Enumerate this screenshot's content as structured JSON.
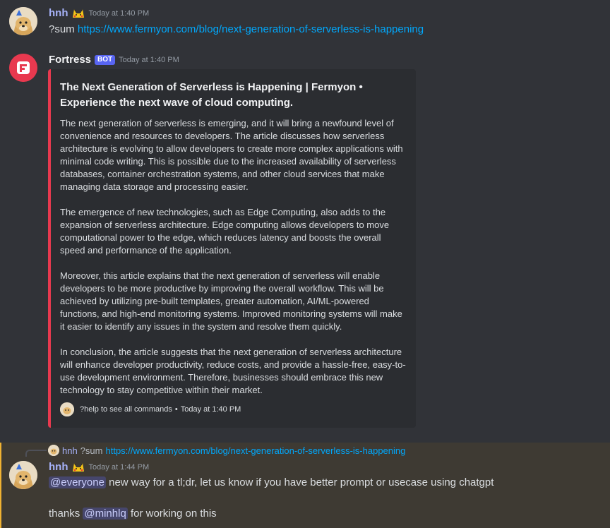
{
  "messages": [
    {
      "username": "hnh",
      "timestamp": "Today at 1:40 PM",
      "command": "?sum",
      "link": "https://www.fermyon.com/blog/next-generation-of-serverless-is-happening"
    },
    {
      "username": "Fortress",
      "bot_tag": "BOT",
      "timestamp": "Today at 1:40 PM",
      "embed": {
        "title": "The Next Generation of Serverless is Happening | Fermyon • Experience the next wave of cloud computing.",
        "paragraphs": [
          "The next generation of serverless is emerging, and it will bring a newfound level of convenience and resources to developers. The article discusses how serverless architecture is evolving to allow developers to create more complex applications with minimal code writing. This is possible due to the increased availability of serverless databases, container orchestration systems, and other cloud services that make managing data storage and processing easier.",
          "The emergence of new technologies, such as Edge Computing, also adds to the expansion of serverless architecture. Edge computing allows developers to move computational power to the edge, which reduces latency and boosts the overall speed and performance of the application.",
          "Moreover, this article explains that the next generation of serverless will enable developers to be more productive by improving the overall workflow. This will be achieved by utilizing pre-built templates, greater automation, AI/ML-powered functions, and high-end monitoring systems. Improved monitoring systems will make it easier to identify any issues in the system and resolve them quickly.",
          "In conclusion, the article suggests that the next generation of serverless architecture will enhance developer productivity, reduce costs, and provide a hassle-free, easy-to-use development environment. Therefore, businesses should embrace this new technology to stay competitive within their market."
        ],
        "footer_text": "?help to see all commands",
        "footer_sep": "•",
        "footer_time": "Today at 1:40 PM",
        "accent_color": "#e8394f"
      }
    },
    {
      "reply_to": {
        "username": "hnh",
        "text": "?sum",
        "link": "https://www.fermyon.com/blog/next-generation-of-serverless-is-happening"
      },
      "username": "hnh",
      "timestamp": "Today at 1:44 PM",
      "line1_mention": "@everyone",
      "line1_text": " new way for a tl;dr, let us know if you have better prompt or usecase using chatgpt",
      "line2_prefix": "thanks ",
      "line2_mention": "@minhlq",
      "line2_suffix": " for working on this"
    }
  ],
  "icons": {
    "user_badge": "pikachu-emoji-icon",
    "bot_avatar": "fortress-logo-icon"
  }
}
